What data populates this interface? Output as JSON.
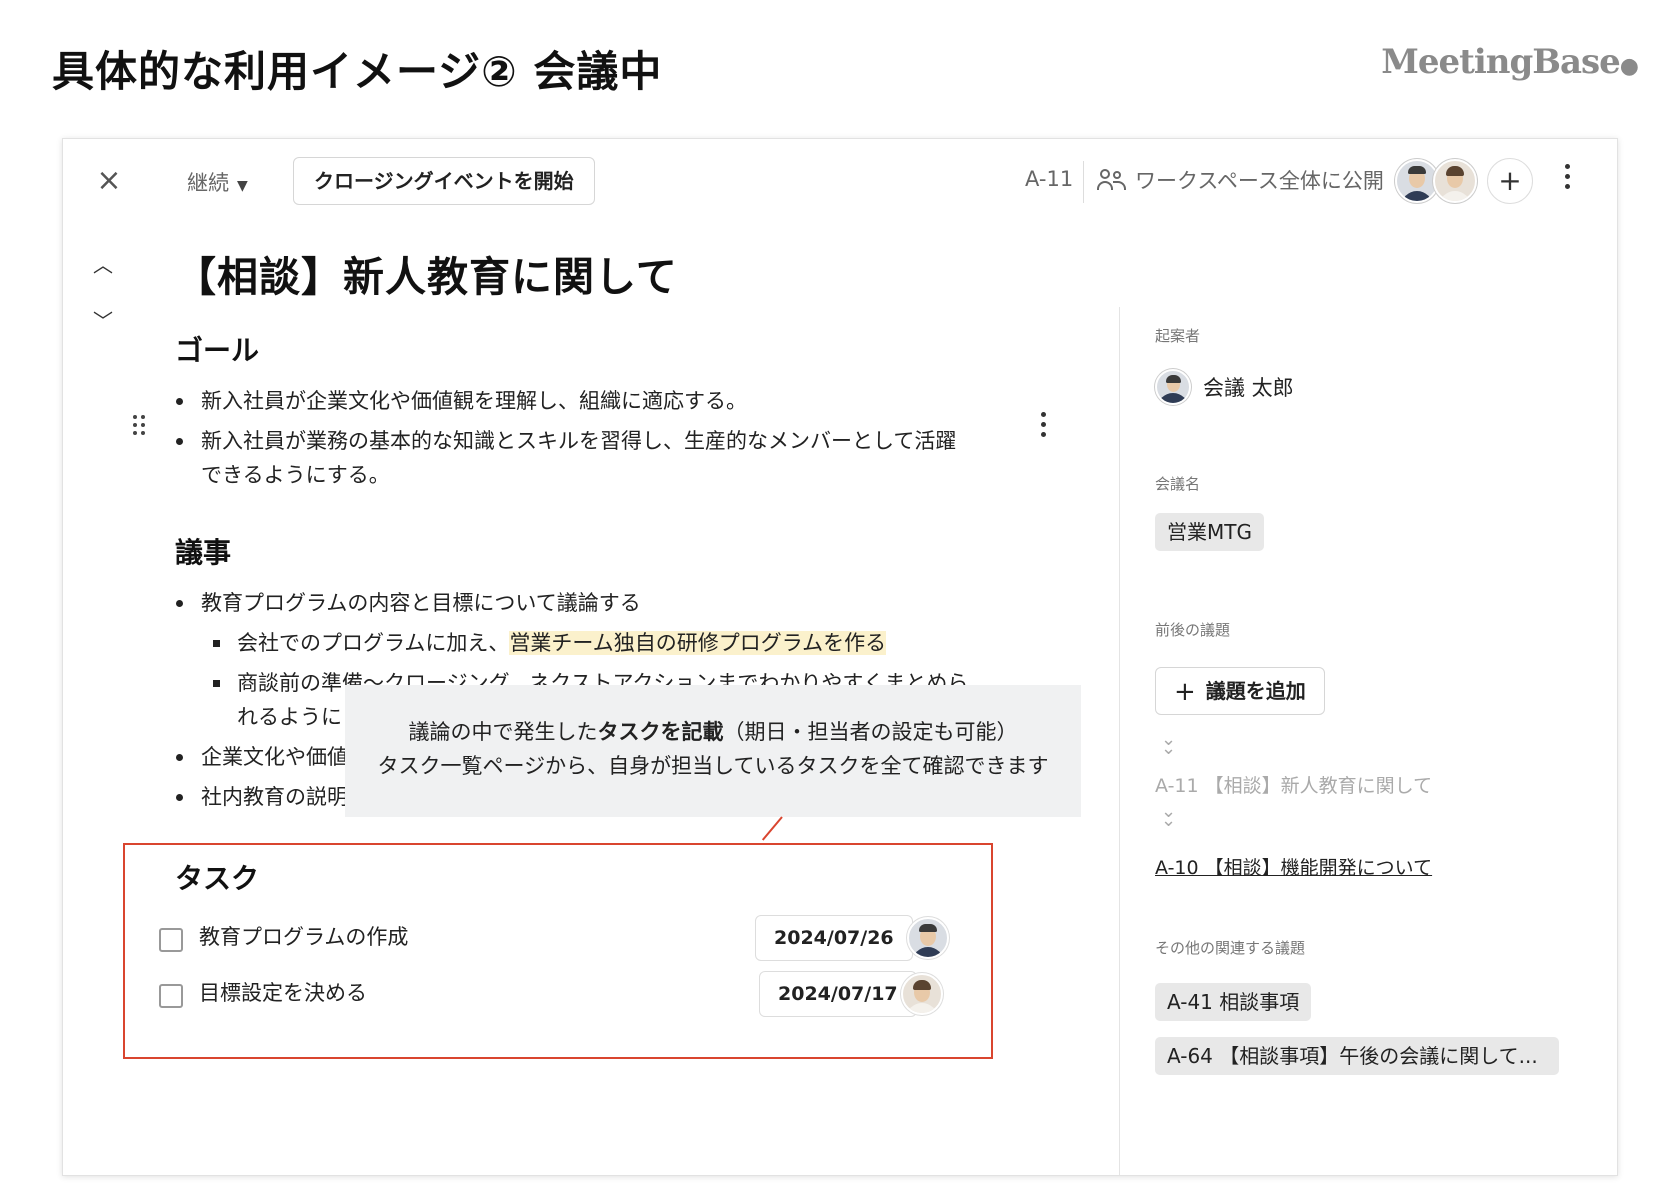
{
  "slide": {
    "title": "具体的な利用イメージ② 会議中",
    "brand": "MeetingBase"
  },
  "topbar": {
    "status": "継続",
    "closing_button": "クロージングイベントを開始",
    "issue_id": "A-11",
    "visibility": "ワークスペース全体に公開"
  },
  "document": {
    "title": "【相談】新人教育に関して",
    "goal_heading": "ゴール",
    "goal_items": [
      "新入社員が企業文化や価値観を理解し、組織に適応する。",
      "新入社員が業務の基本的な知識とスキルを習得し、生産的なメンバーとして活躍",
      "できるようにする。"
    ],
    "agenda_heading": "議事",
    "agenda_items": [
      "教育プログラムの内容と目標について議論する",
      "企業文化や価値",
      "社内教育の説明"
    ],
    "agenda_subitems": [
      "会社でのプログラムに加え、",
      "営業チーム独自の研修プログラムを作る",
      "商談前の準備〜クロージング、ネクストアクションまでわかりやすくまとめら",
      "れるように"
    ],
    "callout": {
      "line1_pre": "議論の中で発生した",
      "line1_bold": "タスクを記載",
      "line1_post": "（期日・担当者の設定も可能）",
      "line2": "タスク一覧ページから、自身が担当しているタスクを全て確認できます"
    },
    "task_heading": "タスク",
    "tasks": [
      {
        "label": "教育プログラムの作成",
        "due": "2024/07/26",
        "assignee": "male"
      },
      {
        "label": "目標設定を決める",
        "due": "2024/07/17",
        "assignee": "female"
      }
    ]
  },
  "sidebar": {
    "proposer_label": "起案者",
    "proposer_name": "会議 太郎",
    "meeting_label": "会議名",
    "meeting_name": "営業MTG",
    "adjacent_label": "前後の議題",
    "add_topic": "議題を追加",
    "current_topic": "A-11 【相談】新人教育に関して",
    "previous_topic": "A-10 【相談】機能開発について",
    "related_label": "その他の関連する議題",
    "related": [
      "A-41 相談事項",
      "A-64 【相談事項】午後の会議に関して..."
    ]
  },
  "colors": {
    "accent_border": "#d9452f",
    "highlight": "#fbf1cc",
    "chip": "#e8e8e8"
  }
}
